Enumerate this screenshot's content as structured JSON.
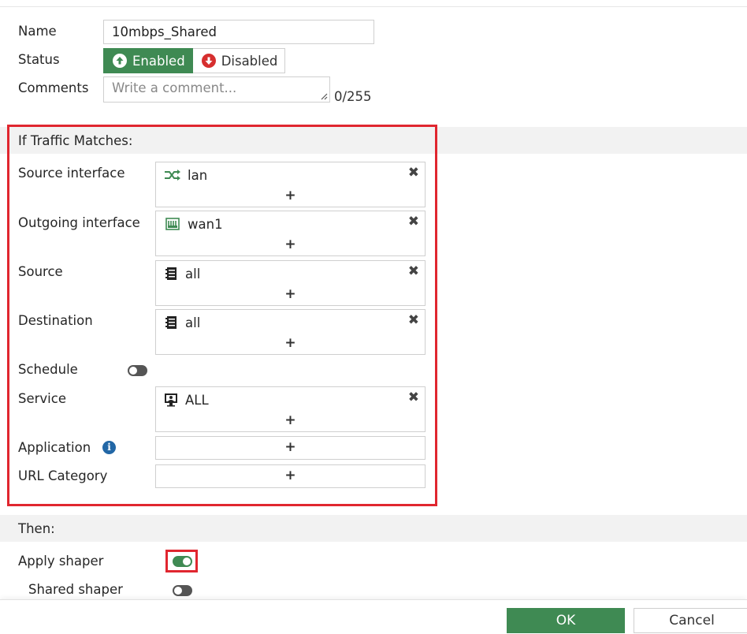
{
  "form": {
    "name_label": "Name",
    "name_value": "10mbps_Shared",
    "status_label": "Status",
    "status_enabled": "Enabled",
    "status_disabled": "Disabled",
    "comments_label": "Comments",
    "comments_placeholder": "Write a comment...",
    "comments_counter": "0/255"
  },
  "match": {
    "title": "If Traffic Matches:",
    "source_interface_label": "Source interface",
    "source_interface_value": "lan",
    "outgoing_interface_label": "Outgoing interface",
    "outgoing_interface_value": "wan1",
    "source_label": "Source",
    "source_value": "all",
    "destination_label": "Destination",
    "destination_value": "all",
    "schedule_label": "Schedule",
    "schedule_enabled": false,
    "service_label": "Service",
    "service_value": "ALL",
    "application_label": "Application",
    "url_category_label": "URL Category",
    "add_symbol": "+",
    "remove_symbol": "✖"
  },
  "then": {
    "title": "Then:",
    "apply_shaper_label": "Apply shaper",
    "apply_shaper_enabled": true,
    "shared_shaper_label": "Shared shaper",
    "shared_shaper_enabled": false
  },
  "footer": {
    "ok_label": "OK",
    "cancel_label": "Cancel"
  },
  "colors": {
    "accent_green": "#3f8a53",
    "highlight_red": "#e0262f",
    "info_blue": "#2267a6"
  },
  "icons": {
    "interface_lan": "shuffle-arrows-icon",
    "interface_wan": "network-port-icon",
    "address": "address-book-icon",
    "service": "service-monitor-icon",
    "remove": "close-x-icon",
    "info": "info-icon"
  }
}
